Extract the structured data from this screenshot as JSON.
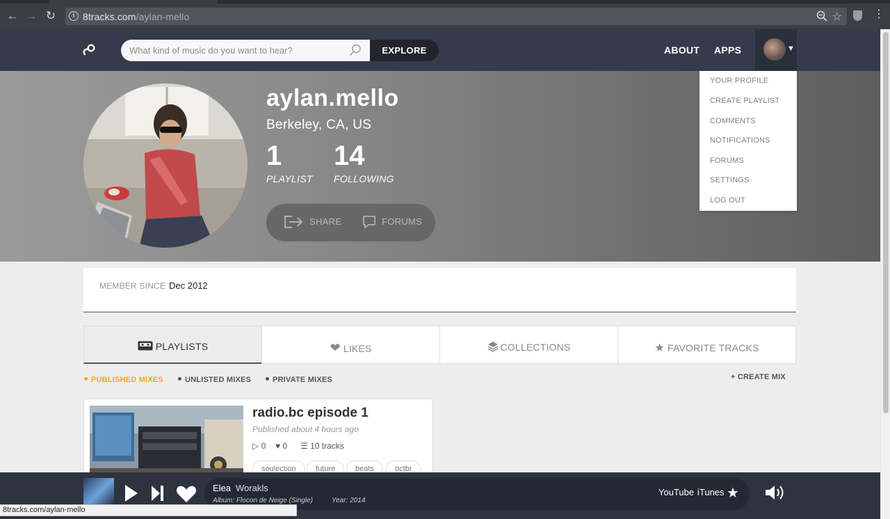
{
  "browser": {
    "url_host": "8tracks.com",
    "url_path": "/aylan-mello",
    "status_url": "8tracks.com/aylan-mello"
  },
  "header": {
    "search_placeholder": "What kind of music do you want to hear?",
    "explore_label": "EXPLORE",
    "about_label": "ABOUT",
    "apps_label": "APPS"
  },
  "dropdown": {
    "items": [
      "YOUR PROFILE",
      "CREATE PLAYLIST",
      "COMMENTS",
      "NOTIFICATIONS",
      "FORUMS",
      "SETTINGS",
      "LOG OUT"
    ]
  },
  "profile": {
    "name": "aylan.mello",
    "location": "Berkeley, CA, US",
    "playlist_count": "1",
    "playlist_label": "PLAYLIST",
    "following_count": "14",
    "following_label": "FOLLOWING",
    "share_label": "SHARE",
    "forums_label": "FORUMS"
  },
  "member": {
    "label": "MEMBER SINCE",
    "value": "Dec 2012"
  },
  "tabs": [
    "PLAYLISTS",
    "LIKES",
    "COLLECTIONS",
    "FAVORITE TRACKS"
  ],
  "subnav": {
    "published": "PUBLISHED MIXES",
    "unlisted": "UNLISTED MIXES",
    "private": "PRIVATE MIXES",
    "create": "+ CREATE MIX"
  },
  "mix": {
    "title": "radio.bc episode 1",
    "published": "Published about 4 hours ago",
    "plays": "0",
    "likes": "0",
    "tracks": "10 tracks",
    "tags": [
      "soulection",
      "future",
      "beats",
      "octbr"
    ]
  },
  "player": {
    "track": "Elea",
    "artist": "Worakls",
    "album": "Album: Flocon de Neige (Single)",
    "year": "Year: 2014",
    "youtube": "YouTube",
    "itunes": "iTunes"
  },
  "colors": {
    "header_bg": "#353b4b",
    "accent": "#f4a623",
    "player_bg": "#2e3340"
  }
}
